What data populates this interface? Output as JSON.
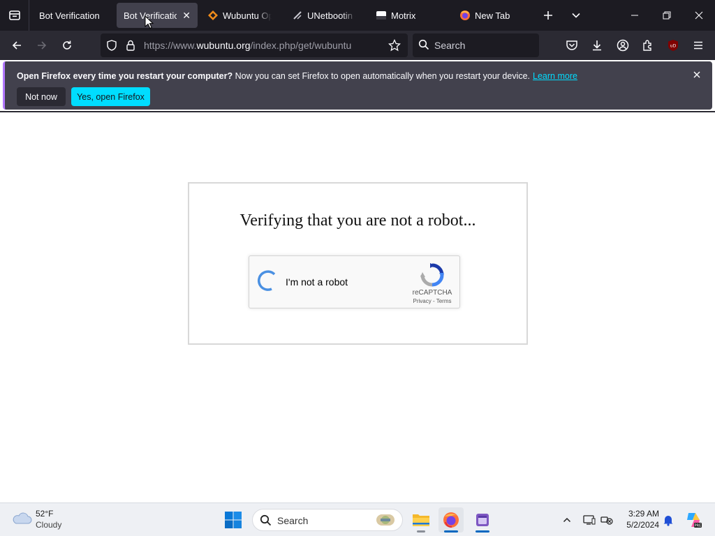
{
  "browser": {
    "tabs": [
      {
        "title": "Bot Verification",
        "active": false,
        "favicon": "none"
      },
      {
        "title": "Bot Verification",
        "active": true,
        "favicon": "none"
      },
      {
        "title": "Wubuntu Ope",
        "active": false,
        "favicon": "wubuntu-diamond-icon"
      },
      {
        "title": "UNetbootin - I",
        "active": false,
        "favicon": "unetbootin-icon"
      },
      {
        "title": "Motrix",
        "active": false,
        "favicon": "motrix-icon"
      },
      {
        "title": "New Tab",
        "active": false,
        "favicon": "firefox-icon"
      }
    ],
    "url": {
      "prefix": "https://www.",
      "host": "wubuntu.org",
      "path": "/index.php/get/wubuntu"
    },
    "search_placeholder": "Search"
  },
  "notification": {
    "bold": "Open Firefox every time you restart your computer?",
    "text": " Now you can set Firefox to open automatically when you restart your device.",
    "link": "Learn more",
    "not_now": "Not now",
    "yes": "Yes, open Firefox"
  },
  "page": {
    "heading": "Verifying that you are not a robot...",
    "recaptcha": {
      "label": "I'm not a robot",
      "brand": "reCAPTCHA",
      "links": "Privacy - Terms"
    }
  },
  "taskbar": {
    "weather": {
      "temp": "52°F",
      "condition": "Cloudy"
    },
    "search_placeholder": "Search",
    "time": "3:29 AM",
    "date": "5/2/2024"
  },
  "colors": {
    "accent": "#00ddff",
    "tab_strip": "#1c1b22",
    "toolbar": "#2b2a33",
    "notification_bg": "#42414d",
    "recaptcha_blue": "#4a90e2"
  }
}
